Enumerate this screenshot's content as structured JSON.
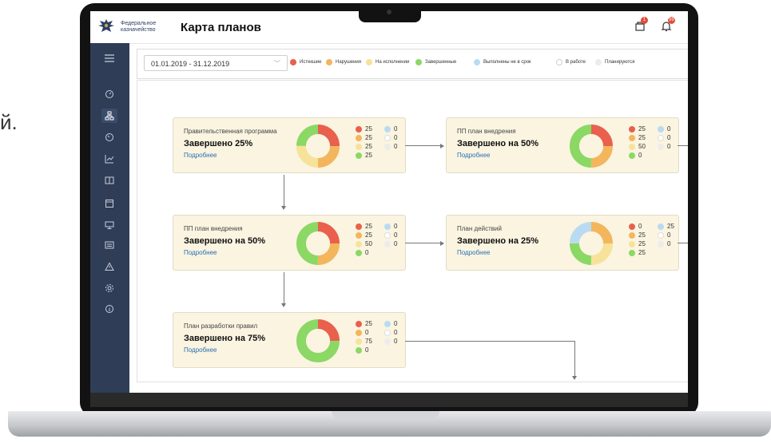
{
  "background_text": "й.",
  "app": {
    "org_name_line1": "Федеральное",
    "org_name_line2": "казначейство",
    "title": "Карта планов",
    "notifications": {
      "docs_badge": "1",
      "bell_badge": "99"
    }
  },
  "sidebar": {
    "items": [
      {
        "icon": "menu-icon"
      },
      {
        "icon": "dashboard-icon"
      },
      {
        "icon": "hierarchy-icon",
        "active": true
      },
      {
        "icon": "gauge-icon"
      },
      {
        "icon": "chart-icon"
      },
      {
        "icon": "book-icon"
      },
      {
        "icon": "calendar-icon"
      },
      {
        "icon": "monitor-icon"
      },
      {
        "icon": "list-icon"
      },
      {
        "icon": "warning-icon"
      },
      {
        "icon": "settings-icon"
      },
      {
        "icon": "info-icon"
      }
    ]
  },
  "filter": {
    "date_range": "01.01.2019 - 31.12.2019",
    "legend": [
      {
        "label": "Истекшие",
        "color": "#e9604d"
      },
      {
        "label": "Нарушения",
        "color": "#f3b65c"
      },
      {
        "label": "На исполнении",
        "color": "#f7e29a"
      },
      {
        "label": "Завершенные",
        "color": "#8bd865"
      },
      {
        "label": "Выполнены не в срок",
        "color": "#b9dbf2"
      },
      {
        "label": "В работе",
        "color": "#ffffff"
      },
      {
        "label": "Планируются",
        "color": "#ececec"
      }
    ]
  },
  "details_label": "Подробнее",
  "cards": [
    {
      "name": "Правительственная программа",
      "status": "Завершено 25%",
      "segments": [
        25,
        25,
        25,
        25,
        0,
        0,
        0
      ],
      "left_values": [
        "25",
        "25",
        "25",
        "25"
      ],
      "right_values": [
        "0",
        "0",
        "0"
      ]
    },
    {
      "name": "ПП план внедрения",
      "status": "Завершено на 50%",
      "segments": [
        25,
        25,
        0,
        50,
        0,
        0,
        0
      ],
      "left_values": [
        "25",
        "25",
        "50",
        "0"
      ],
      "right_values": [
        "0",
        "0",
        "0"
      ]
    },
    {
      "name": "ПП план внедрения",
      "status": "Завершено на 50%",
      "segments": [
        25,
        25,
        0,
        50,
        0,
        0,
        0
      ],
      "left_values": [
        "25",
        "25",
        "50",
        "0"
      ],
      "right_values": [
        "0",
        "0",
        "0"
      ]
    },
    {
      "name": "План действий",
      "status": "Завершено на 25%",
      "segments": [
        0,
        25,
        25,
        25,
        25,
        0,
        0
      ],
      "left_values": [
        "0",
        "25",
        "25",
        "25"
      ],
      "right_values": [
        "25",
        "0",
        "0"
      ]
    },
    {
      "name": "План разработки правил",
      "status": "Завершено на 75%",
      "segments": [
        25,
        0,
        0,
        75,
        0,
        0,
        0
      ],
      "left_values": [
        "25",
        "0",
        "75",
        "0"
      ],
      "right_values": [
        "0",
        "0",
        "0"
      ]
    }
  ]
}
